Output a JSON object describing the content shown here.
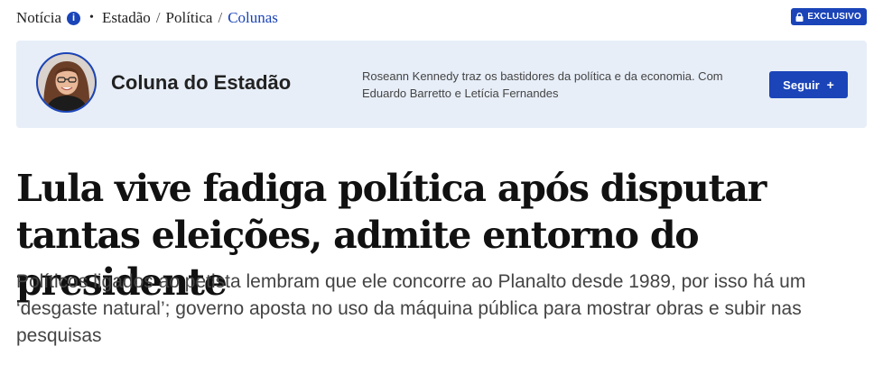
{
  "breadcrumb": {
    "section": "Notícia",
    "info_icon": "info-icon",
    "separator_dot": "•",
    "path_1": "Estadão",
    "path_sep": "/",
    "path_2": "Política",
    "path_3": "Colunas"
  },
  "badge": {
    "label": "EXCLUSIVO",
    "icon": "lock-icon"
  },
  "column": {
    "name": "Coluna do Estadão",
    "description": "Roseann Kennedy traz os bastidores da política e da economia. Com Eduardo Barretto e Letícia Fernandes",
    "follow_label": "Seguir",
    "follow_icon": "+"
  },
  "article": {
    "headline": "Lula vive fadiga política após disputar tantas eleições, admite entorno do presidente",
    "subheadline": "Políticos ligados ao petista lembram que ele concorre ao Planalto desde 1989, por isso há um ‘desgaste natural’; governo aposta no uso da máquina pública para mostrar obras e subir nas pesquisas"
  },
  "colors": {
    "accent": "#1a44b8",
    "column_bg": "#e7eef8"
  }
}
